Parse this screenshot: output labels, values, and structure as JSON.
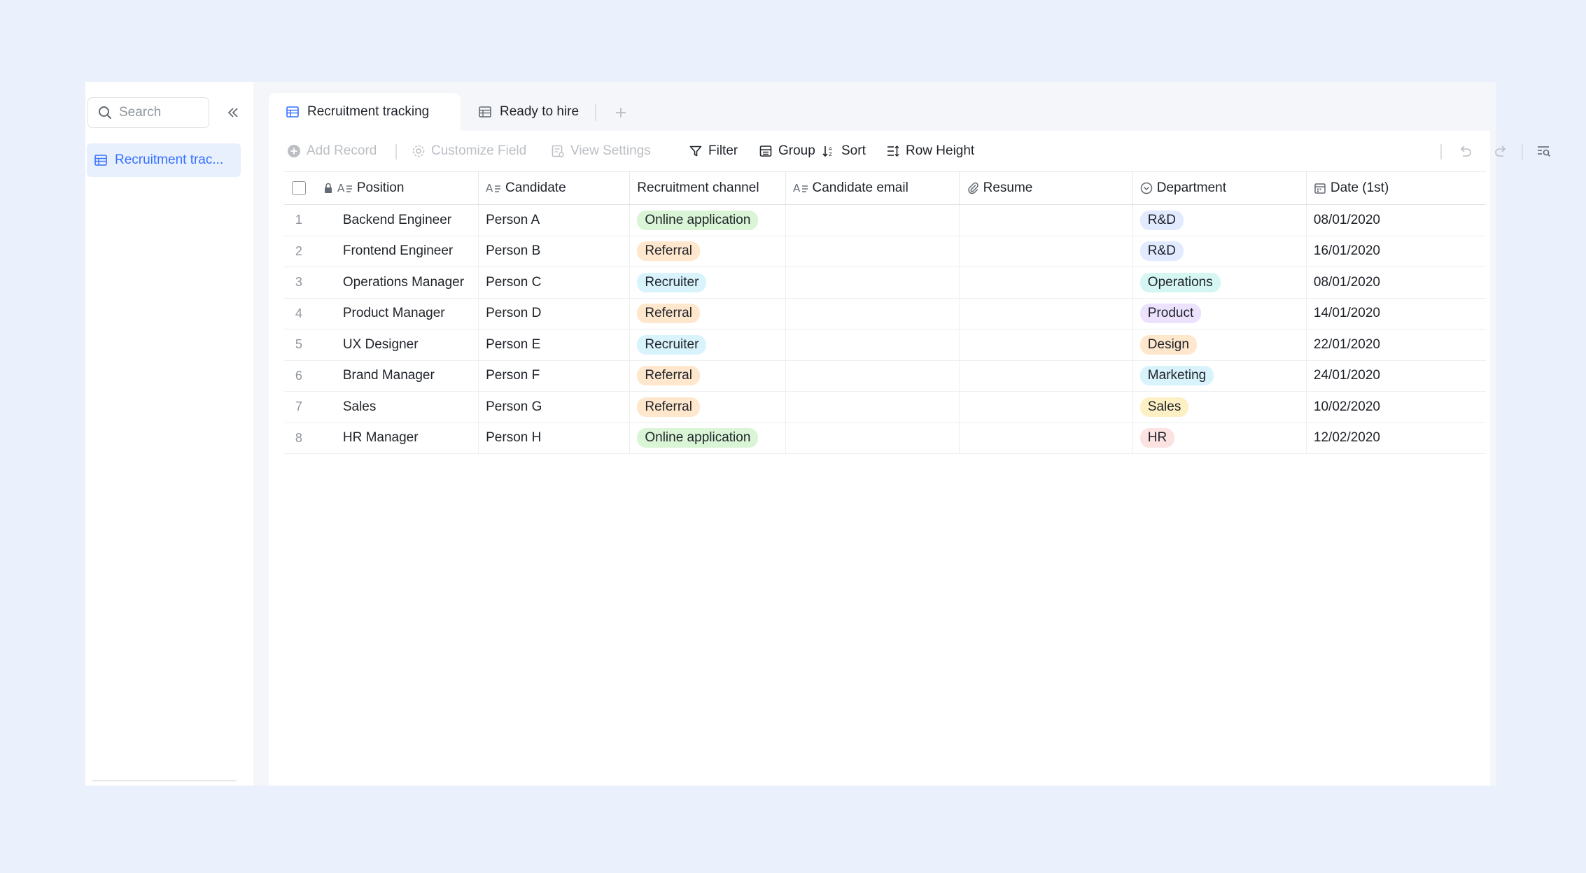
{
  "sidebar": {
    "search_placeholder": "Search",
    "items": [
      {
        "label": "Recruitment trac..."
      }
    ]
  },
  "tabs": [
    {
      "label": "Recruitment tracking",
      "active": true
    },
    {
      "label": "Ready to hire",
      "active": false
    }
  ],
  "toolbar": {
    "add_record": "Add Record",
    "customize_field": "Customize Field",
    "view_settings": "View Settings",
    "filter": "Filter",
    "group": "Group",
    "sort": "Sort",
    "row_height": "Row Height"
  },
  "table": {
    "columns": {
      "position": "Position",
      "candidate": "Candidate",
      "channel": "Recruitment channel",
      "email": "Candidate email",
      "resume": "Resume",
      "department": "Department",
      "date": "Date (1st)"
    },
    "rows": [
      {
        "index": "1",
        "position": "Backend Engineer",
        "candidate": "Person A",
        "channel": "Online application",
        "email": "",
        "resume": "",
        "department": "R&D",
        "date": "08/01/2020"
      },
      {
        "index": "2",
        "position": "Frontend Engineer",
        "candidate": "Person B",
        "channel": "Referral",
        "email": "",
        "resume": "",
        "department": "R&D",
        "date": "16/01/2020"
      },
      {
        "index": "3",
        "position": "Operations Manager",
        "candidate": "Person C",
        "channel": "Recruiter",
        "email": "",
        "resume": "",
        "department": "Operations",
        "date": "08/01/2020"
      },
      {
        "index": "4",
        "position": "Product Manager",
        "candidate": "Person D",
        "channel": "Referral",
        "email": "",
        "resume": "",
        "department": "Product",
        "date": "14/01/2020"
      },
      {
        "index": "5",
        "position": "UX Designer",
        "candidate": "Person E",
        "channel": "Recruiter",
        "email": "",
        "resume": "",
        "department": "Design",
        "date": "22/01/2020"
      },
      {
        "index": "6",
        "position": "Brand Manager",
        "candidate": "Person F",
        "channel": "Referral",
        "email": "",
        "resume": "",
        "department": "Marketing",
        "date": "24/01/2020"
      },
      {
        "index": "7",
        "position": "Sales",
        "candidate": "Person G",
        "channel": "Referral",
        "email": "",
        "resume": "",
        "department": "Sales",
        "date": "10/02/2020"
      },
      {
        "index": "8",
        "position": "HR Manager",
        "candidate": "Person H",
        "channel": "Online application",
        "email": "",
        "resume": "",
        "department": "HR",
        "date": "12/02/2020"
      }
    ]
  },
  "tag_colors": {
    "Online application": "c-green",
    "Referral": "c-orange",
    "Recruiter": "c-blue",
    "R&D": "c-indigo",
    "Operations": "c-teal",
    "Product": "c-purple",
    "Design": "c-orange",
    "Marketing": "c-blue",
    "Sales": "c-yellow",
    "HR": "c-red"
  },
  "colors": {
    "accent": "#3370ff",
    "background": "#eaf0fc"
  }
}
